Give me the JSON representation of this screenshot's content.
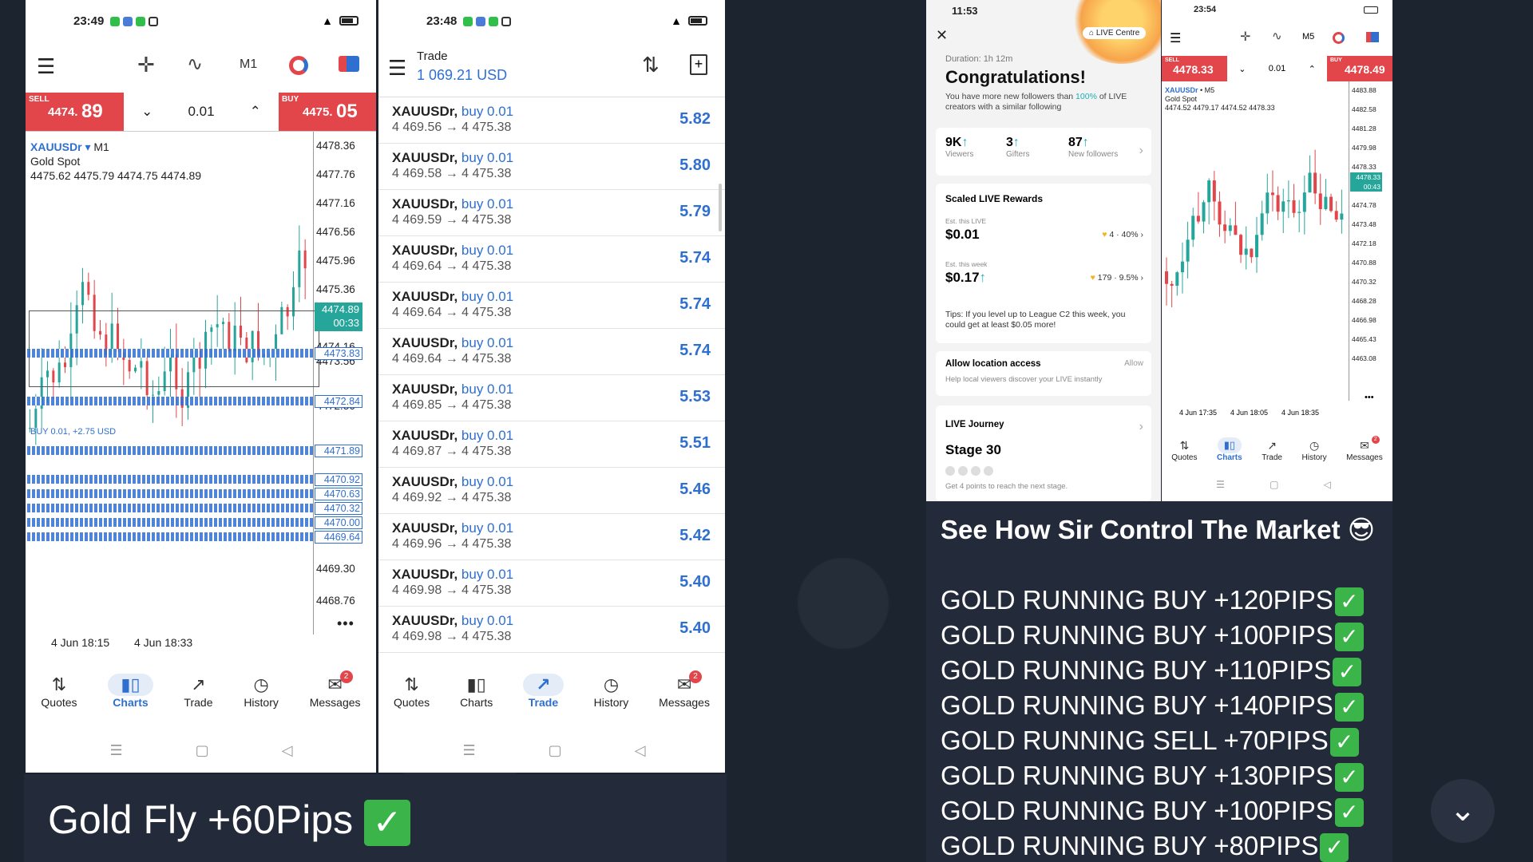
{
  "phone1": {
    "time": "23:49",
    "menu_tab": "M1",
    "sell_label": "SELL",
    "sell_small": "4474.",
    "sell_big": "89",
    "lot": "0.01",
    "buy_label": "BUY",
    "buy_small": "4475.",
    "buy_big": "05",
    "symbol": "XAUUSDr",
    "timeframe": "M1",
    "symbol_desc": "Gold Spot",
    "ohlc": "4475.62 4475.79 4474.75 4474.89",
    "axis": [
      "4478.36",
      "4477.76",
      "4477.16",
      "4476.56",
      "4475.96",
      "4475.36",
      "4474.16",
      "4473.56",
      "4472.36",
      "4469.30",
      "4468.76"
    ],
    "current_price": "4474.89",
    "current_timer": "00:33",
    "levels": [
      "4473.83",
      "4472.84",
      "4471.89",
      "4470.92",
      "4470.63",
      "4470.32",
      "4470.00",
      "4469.64"
    ],
    "trade_lbl": "BUY 0.01, +2.75 USD",
    "xlabels": [
      "4 Jun 18:15",
      "4 Jun 18:33"
    ],
    "nav": [
      "Quotes",
      "Charts",
      "Trade",
      "History",
      "Messages"
    ],
    "badge": "2"
  },
  "phone2": {
    "time": "23:48",
    "title": "Trade",
    "balance": "1 069.21 USD",
    "rows": [
      {
        "sym": "XAUUSDr,",
        "type": "buy 0.01",
        "prices": "4 469.56 → 4 475.38",
        "profit": "5.82"
      },
      {
        "sym": "XAUUSDr,",
        "type": "buy 0.01",
        "prices": "4 469.58 → 4 475.38",
        "profit": "5.80"
      },
      {
        "sym": "XAUUSDr,",
        "type": "buy 0.01",
        "prices": "4 469.59 → 4 475.38",
        "profit": "5.79"
      },
      {
        "sym": "XAUUSDr,",
        "type": "buy 0.01",
        "prices": "4 469.64 → 4 475.38",
        "profit": "5.74"
      },
      {
        "sym": "XAUUSDr,",
        "type": "buy 0.01",
        "prices": "4 469.64 → 4 475.38",
        "profit": "5.74"
      },
      {
        "sym": "XAUUSDr,",
        "type": "buy 0.01",
        "prices": "4 469.64 → 4 475.38",
        "profit": "5.74"
      },
      {
        "sym": "XAUUSDr,",
        "type": "buy 0.01",
        "prices": "4 469.85 → 4 475.38",
        "profit": "5.53"
      },
      {
        "sym": "XAUUSDr,",
        "type": "buy 0.01",
        "prices": "4 469.87 → 4 475.38",
        "profit": "5.51"
      },
      {
        "sym": "XAUUSDr,",
        "type": "buy 0.01",
        "prices": "4 469.92 → 4 475.38",
        "profit": "5.46"
      },
      {
        "sym": "XAUUSDr,",
        "type": "buy 0.01",
        "prices": "4 469.96 → 4 475.38",
        "profit": "5.42"
      },
      {
        "sym": "XAUUSDr,",
        "type": "buy 0.01",
        "prices": "4 469.98 → 4 475.38",
        "profit": "5.40"
      },
      {
        "sym": "XAUUSDr,",
        "type": "buy 0.01",
        "prices": "4 469.98 → 4 475.38",
        "profit": "5.40"
      }
    ],
    "nav": [
      "Quotes",
      "Charts",
      "Trade",
      "History",
      "Messages"
    ],
    "badge": "2"
  },
  "caption_left": "Gold Fly +60Pips",
  "live": {
    "time": "11:53",
    "live_centre": "LIVE Centre",
    "duration": "Duration: 1h 12m",
    "congrats": "Congratulations!",
    "followers_pre": "You have more new followers than ",
    "followers_pct": "100%",
    "followers_post": " of LIVE creators with a similar following",
    "stats": [
      {
        "v": "9K",
        "l": "Viewers"
      },
      {
        "v": "3",
        "l": "Gifters"
      },
      {
        "v": "87",
        "l": "New followers"
      }
    ],
    "rewards_title": "Scaled LIVE Rewards",
    "est_live_label": "Est. this LIVE",
    "est_live": "$0.01",
    "est_live_right": "4 · 40%",
    "est_week_label": "Est. this week",
    "est_week": "$0.17",
    "est_week_right": "179 · 9.5%",
    "tips": "Tips: If you level up to League C2 this week, you could get at least $0.05 more!",
    "loc_title": "Allow location access",
    "loc_allow": "Allow",
    "loc_sub": "Help local viewers discover your LIVE instantly",
    "journey": "LIVE Journey",
    "stage": "Stage 30",
    "stage_sub": "Get 4 points to reach the next stage."
  },
  "phone3": {
    "time": "23:54",
    "menu_tab": "M5",
    "sell_label": "SELL",
    "sell": "4478.33",
    "lot": "0.01",
    "buy_label": "BUY",
    "buy": "4478.49",
    "symbol": "XAUUSDr",
    "timeframe": "M5",
    "symbol_desc": "Gold Spot",
    "ohlc": "4474.52 4479.17 4474.52 4478.33",
    "axis": [
      "4483.88",
      "4482.58",
      "4481.28",
      "4479.98",
      "4478.33",
      "4476.08",
      "4474.78",
      "4473.48",
      "4472.18",
      "4470.88",
      "4470.32",
      "4468.28",
      "4466.98",
      "4465.43",
      "4463.08"
    ],
    "timer": "00:43",
    "xlabels": [
      "4 Jun 17:35",
      "4 Jun 18:05",
      "4 Jun 18:35"
    ],
    "nav": [
      "Quotes",
      "Charts",
      "Trade",
      "History",
      "Messages"
    ],
    "badge": "2"
  },
  "headline": "See How Sir Control The Market 😎",
  "results": [
    "GOLD RUNNING BUY +120PIPS",
    "GOLD RUNNING BUY +100PIPS",
    "GOLD RUNNING BUY +110PIPS",
    "GOLD RUNNING BUY +140PIPS",
    "GOLD RUNNING SELL +70PIPS",
    "GOLD RUNNING BUY +130PIPS",
    "GOLD RUNNING BUY +100PIPS",
    "GOLD RUNNING BUY +80PIPS"
  ],
  "check": "✓",
  "colors": {
    "sell": "#e2454a",
    "buy": "#2f6fd0",
    "up": "#26a69a",
    "down": "#e2454a"
  }
}
